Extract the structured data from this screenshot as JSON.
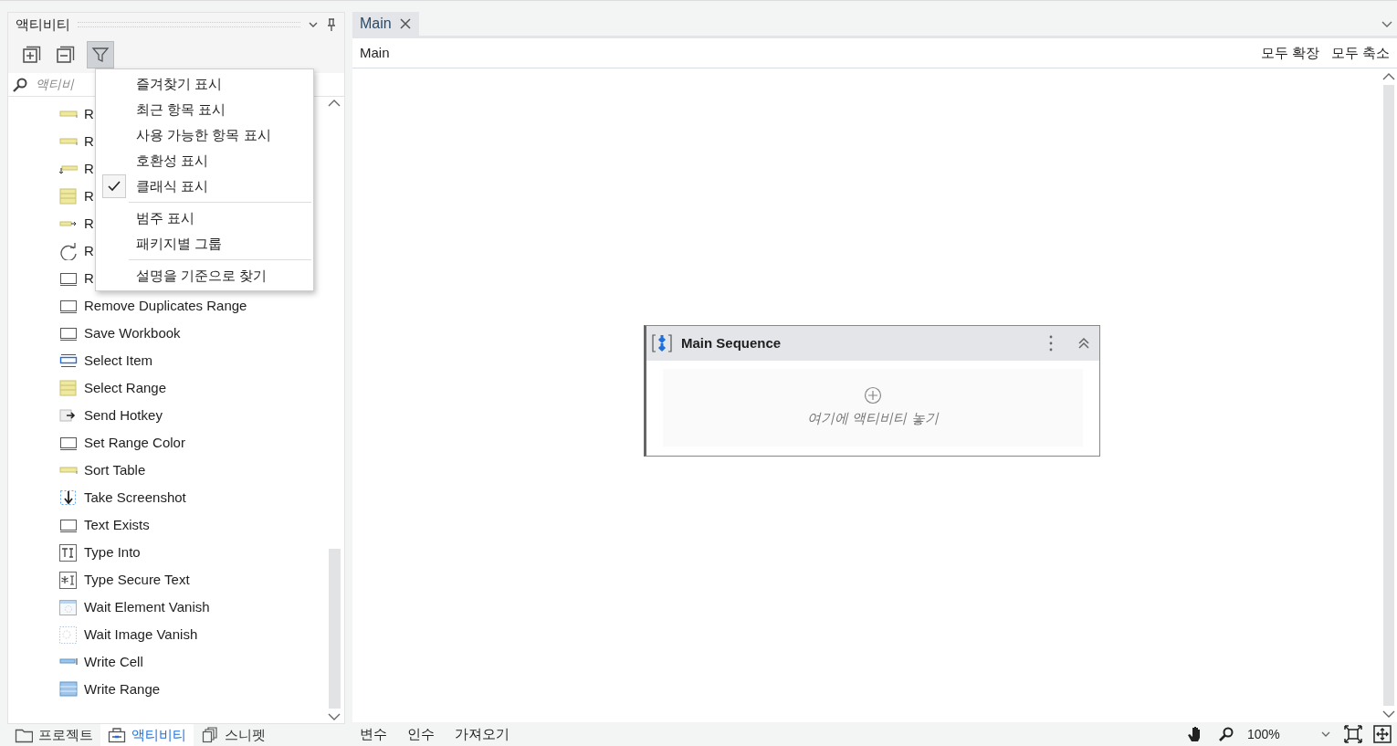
{
  "activities_panel": {
    "title": "액티비티",
    "search": {
      "placeholder": "액티비"
    },
    "items": [
      {
        "kind": "cell",
        "label": "R"
      },
      {
        "kind": "cell",
        "label": "R"
      },
      {
        "kind": "read-cell",
        "label": "R"
      },
      {
        "kind": "cells",
        "label": "R"
      },
      {
        "kind": "cell-arrow",
        "label": "R"
      },
      {
        "kind": "refresh",
        "label": "R"
      },
      {
        "kind": "window",
        "label": "R"
      },
      {
        "kind": "window",
        "label": "Remove Duplicates Range"
      },
      {
        "kind": "window",
        "label": "Save Workbook"
      },
      {
        "kind": "select-item",
        "label": "Select Item"
      },
      {
        "kind": "cells",
        "label": "Select Range"
      },
      {
        "kind": "hotkey",
        "label": "Send Hotkey"
      },
      {
        "kind": "window",
        "label": "Set Range Color"
      },
      {
        "kind": "cell",
        "label": "Sort Table"
      },
      {
        "kind": "screenshot",
        "label": "Take Screenshot"
      },
      {
        "kind": "window",
        "label": "Text Exists"
      },
      {
        "kind": "type-into",
        "label": "Type Into"
      },
      {
        "kind": "secure",
        "label": "Type Secure Text"
      },
      {
        "kind": "wait-element",
        "label": "Wait Element Vanish"
      },
      {
        "kind": "wait-image",
        "label": "Wait Image Vanish"
      },
      {
        "kind": "write-cell",
        "label": "Write Cell"
      },
      {
        "kind": "write-range",
        "label": "Write Range"
      }
    ],
    "filter_menu": {
      "sections": [
        [
          {
            "label": "즐겨찾기 표시",
            "checked": false
          },
          {
            "label": "최근 항목 표시",
            "checked": false
          },
          {
            "label": "사용 가능한 항목 표시",
            "checked": false
          },
          {
            "label": "호환성 표시",
            "checked": false
          },
          {
            "label": "클래식 표시",
            "checked": true
          }
        ],
        [
          {
            "label": "범주 표시",
            "checked": false
          },
          {
            "label": "패키지별 그룹",
            "checked": false
          }
        ],
        [
          {
            "label": "설명을 기준으로 찾기",
            "checked": false
          }
        ]
      ]
    },
    "bottom_tabs": [
      {
        "label": "프로젝트",
        "selected": false
      },
      {
        "label": "액티비티",
        "selected": true
      },
      {
        "label": "스니펫",
        "selected": false
      }
    ]
  },
  "designer": {
    "tabs": [
      {
        "label": "Main",
        "selected": true
      }
    ],
    "breadcrumb": "Main",
    "expand_all": "모두 확장",
    "collapse_all": "모두 축소",
    "sequence": {
      "title": "Main Sequence",
      "drop_hint": "여기에 액티비티 놓기"
    },
    "bottom_bar": {
      "tabs": [
        "변수",
        "인수",
        "가져오기"
      ],
      "zoom": "100%"
    }
  }
}
